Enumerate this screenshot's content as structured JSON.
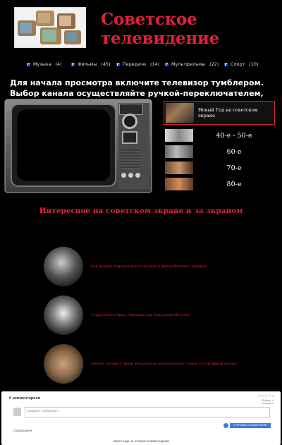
{
  "header": {
    "title": "Советское телевидение"
  },
  "categories": [
    {
      "label": "Музыка",
      "count": "(4)"
    },
    {
      "label": "Фильмы",
      "count": "(45)"
    },
    {
      "label": "Передачи",
      "count": "(14)"
    },
    {
      "label": "Мультфильмы",
      "count": "(22)"
    },
    {
      "label": "Спорт",
      "count": "(10)"
    }
  ],
  "intro": "Для начала просмотра включите телевизор тумблером. Выбор канала осуществляйте ручкой-переключателем, предварительно выбрав",
  "channels": [
    {
      "label": "Новый Год на советском экране"
    },
    {
      "label": "40-е - 50-е"
    },
    {
      "label": "60-е"
    },
    {
      "label": "70-е"
    },
    {
      "label": "80-е"
    }
  ],
  "section_title": "Интересное на советском экране и за экраном",
  "articles": [
    {
      "text": "Как Андрей Миронов влетел на роль в фильм Василия Ливанова"
    },
    {
      "text": "Старательное брать Ливанова для Андропова Молотов"
    },
    {
      "text": "Почему Леонид Гайдай обижался на актеров после съемок «Спортивный мотор»"
    }
  ],
  "comments": {
    "title": "0 комментариев",
    "stars": "☆☆☆☆☆",
    "rating_line1": "Рейтинг: 0",
    "rating_line2": "голосов: 0",
    "placeholder": "Войдите сообщение...",
    "submit": "ОТПРАВИТЬ КОММЕНТАРИЙ",
    "sort": "Сортировка ▾",
    "empty": "Никто ещё не оставил комментариев"
  },
  "colors": {
    "accent": "#d8263f",
    "title": "#e0203a",
    "button": "#3e7ad6"
  }
}
